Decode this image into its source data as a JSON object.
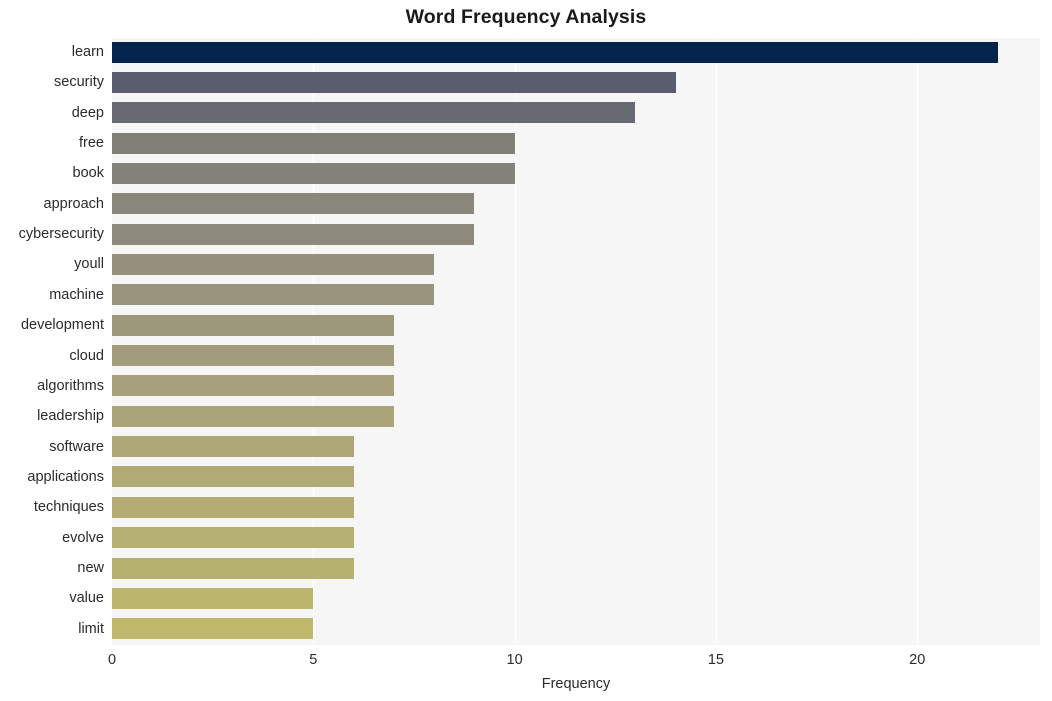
{
  "chart_data": {
    "type": "bar",
    "orientation": "horizontal",
    "title": "Word Frequency Analysis",
    "xlabel": "Frequency",
    "ylabel": "",
    "categories": [
      "learn",
      "security",
      "deep",
      "free",
      "book",
      "approach",
      "cybersecurity",
      "youll",
      "machine",
      "development",
      "cloud",
      "algorithms",
      "leadership",
      "software",
      "applications",
      "techniques",
      "evolve",
      "new",
      "value",
      "limit"
    ],
    "values": [
      22,
      14,
      13,
      10,
      10,
      9,
      9,
      8,
      8,
      7,
      7,
      7,
      7,
      6,
      6,
      6,
      6,
      6,
      5,
      5
    ],
    "bar_colors": [
      "#04244c",
      "#5a5d6d",
      "#676a72",
      "#7f7f78",
      "#84837b",
      "#8a887d",
      "#8d8a7c",
      "#94907c",
      "#99947d",
      "#9d987c",
      "#a29c7c",
      "#a6a07b",
      "#aaa479",
      "#aea877",
      "#b0aa75",
      "#b3ad73",
      "#b5af71",
      "#b7b16f",
      "#bbb56d",
      "#bfb86b"
    ],
    "xticks": [
      0,
      5,
      10,
      15,
      20
    ],
    "xtick_labels": [
      "0",
      "5",
      "10",
      "15",
      "20"
    ],
    "xlim": [
      0,
      23.05
    ],
    "grid": true,
    "grid_axis": "x",
    "legend": "none",
    "plot_background": "#f6f6f7",
    "figure_background": "#ffffff",
    "gridline_color": "#ffffff",
    "text_color": "#2b2b2b",
    "title_color": "#1a1a1a"
  }
}
